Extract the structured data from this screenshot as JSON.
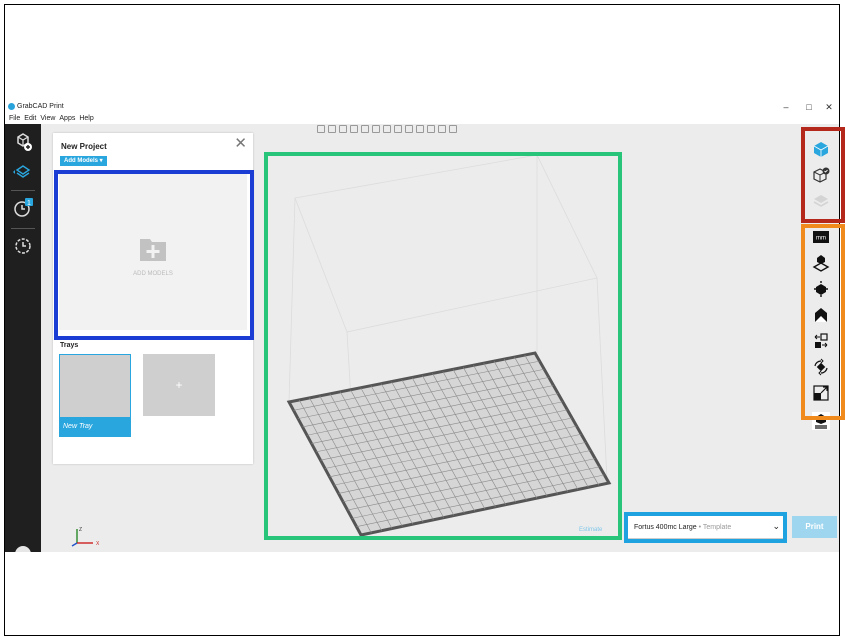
{
  "app": {
    "title": "GrabCAD Print",
    "window_controls": [
      "–",
      "□",
      "✕"
    ],
    "menu": [
      "File",
      "Edit",
      "View",
      "Apps",
      "Help"
    ]
  },
  "project": {
    "title": "New Project",
    "close_glyph": "✕",
    "add_models_label": "Add Models ▾",
    "dropzone_label": "ADD MODELS",
    "trays_label": "Trays",
    "trays": [
      {
        "name": "New Tray"
      },
      {
        "name": "+"
      }
    ]
  },
  "leftbar": {
    "badge_count": "1"
  },
  "viewport": {
    "estimate_label": "Estimate",
    "axis_labels": {
      "z": "Z",
      "x": "X"
    }
  },
  "printer": {
    "name": "Fortus 400mc Large",
    "template": " • Template",
    "chevron": "⌵",
    "print_label": "Print"
  },
  "right_tools": {
    "units_label": "mm"
  },
  "highlight_colors": {
    "panel": "#1c3dd4",
    "viewport": "#27c47a",
    "printer": "#1fa3e0",
    "view_tools": "#b4281c",
    "edit_tools": "#f08a1c"
  }
}
